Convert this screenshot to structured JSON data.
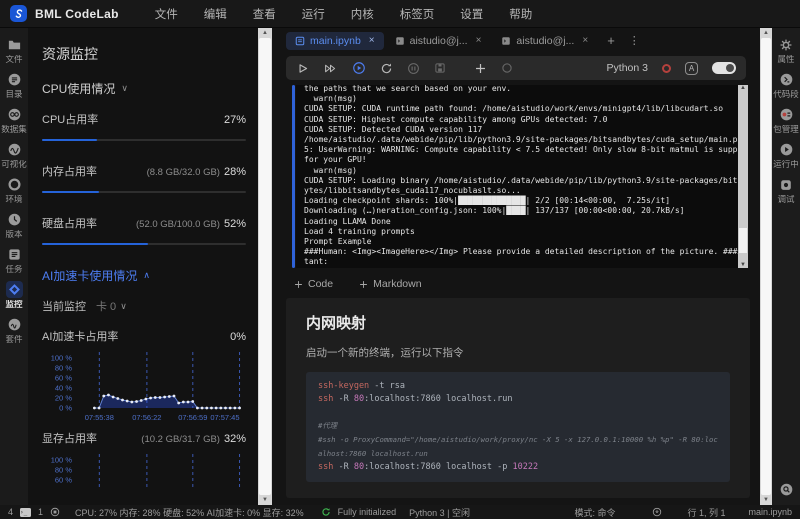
{
  "app": {
    "logo_text": "BML CodeLab",
    "menus": [
      "文件",
      "编辑",
      "查看",
      "运行",
      "内核",
      "标签页",
      "设置",
      "帮助"
    ]
  },
  "left_bar": {
    "items": [
      {
        "label": "文件"
      },
      {
        "label": "目录"
      },
      {
        "label": "数据集"
      },
      {
        "label": "可视化"
      },
      {
        "label": "环境"
      },
      {
        "label": "版本"
      },
      {
        "label": "任务"
      },
      {
        "label": "监控",
        "active": true
      },
      {
        "label": "套件"
      }
    ]
  },
  "panel": {
    "title": "资源监控",
    "cpu_section": "CPU使用情况",
    "ai_section": "AI加速卡使用情况",
    "monitor_label": "当前监控",
    "card_select": "卡 0",
    "metrics": [
      {
        "label": "CPU占用率",
        "detail": "",
        "value": "27%",
        "percent": 27
      },
      {
        "label": "内存占用率",
        "detail": "(8.8 GB/32.0 GB)",
        "value": "28%",
        "percent": 28
      },
      {
        "label": "硬盘占用率",
        "detail": "(52.0 GB/100.0 GB)",
        "value": "52%",
        "percent": 52
      }
    ]
  },
  "chart_data": [
    {
      "type": "area",
      "title": "AI加速卡占用率",
      "current_value": "0%",
      "ylabel": "",
      "xlabel": "",
      "ylim": [
        0,
        100
      ],
      "y_ticks": [
        100,
        80,
        60,
        40,
        20,
        0
      ],
      "y_tick_labels": [
        "100 %",
        "80 %",
        "60 %",
        "40 %",
        "20 %",
        "0 %"
      ],
      "x_ticks": [
        "07:55:38",
        "07:56:22",
        "07:56:59",
        "07:57:45"
      ],
      "grid": "vertical-dashed",
      "legend": "none",
      "line_color": "#6383d6",
      "fill_color": "rgba(47,84,235,0.35)",
      "values": [
        0,
        0,
        24,
        26,
        22,
        19,
        16,
        14,
        12,
        13,
        15,
        18,
        20,
        21,
        21,
        22,
        23,
        24,
        10,
        12,
        12,
        13,
        0,
        0,
        0,
        0,
        0,
        0,
        0,
        0,
        0,
        0
      ]
    },
    {
      "type": "area",
      "title": "显存占用率",
      "detail": "(10.2 GB/31.7 GB)",
      "current_value": "32%",
      "ylim": [
        0,
        100
      ],
      "y_ticks": [
        100,
        80,
        60
      ],
      "y_tick_labels": [
        "100 %",
        "80 %",
        "60 %"
      ],
      "x_ticks": [],
      "grid": "vertical-dashed",
      "values": [],
      "note": "chart clipped by viewport bottom"
    }
  ],
  "notebook": {
    "tabs": [
      {
        "label": "main.ipynb",
        "close": "×",
        "active": true
      },
      {
        "label": "aistudio@j...",
        "close": "×",
        "active": false
      },
      {
        "label": "aistudio@j...",
        "close": "×",
        "active": false
      }
    ],
    "toolbar": {
      "kernel_label": "Python 3"
    },
    "console_lines": [
      "the paths that we search based on your env.",
      "  warn(msg)",
      "CUDA SETUP: CUDA runtime path found: /home/aistudio/work/envs/minigpt4/lib/libcudart.so",
      "CUDA SETUP: Highest compute capability among GPUs detected: 7.0",
      "CUDA SETUP: Detected CUDA version 117",
      "/home/aistudio/.data/webide/pip/lib/python3.9/site-packages/bitsandbytes/cuda_setup/main.py:14",
      "5: UserWarning: WARNING: Compute capability < 7.5 detected! Only slow 8-bit matmul is supported",
      "for your GPU!",
      "  warn(msg)",
      "CUDA SETUP: Loading binary /home/aistudio/.data/webide/pip/lib/python3.9/site-packages/bitsandb",
      "ytes/libbitsandbytes_cuda117_nocublaslt.so...",
      "Loading checkpoint shards: 100%|██████████████| 2/2 [00:14<00:00,  7.25s/it]",
      "Downloading (…)neration_config.json: 100%|████| 137/137 [00:00<00:00, 20.7kB/s]",
      "Loading LLAMA Done",
      "Load 4 training prompts",
      "Prompt Example",
      "###Human: <Img><ImageHere></Img> Please provide a detailed description of the picture. ###Assis",
      "tant:"
    ],
    "add_code": "Code",
    "add_markdown": "Markdown",
    "markdown_cell": {
      "heading": "内网映射",
      "paragraph": "启动一个新的终端，运行以下指令",
      "code_lines": [
        [
          [
            "ssh-keygen",
            "kw"
          ],
          [
            " -t rsa",
            "plain"
          ]
        ],
        [
          [
            "ssh",
            "kw"
          ],
          [
            " -R ",
            "plain"
          ],
          [
            "80",
            "num"
          ],
          [
            ":localhost:7860 localhost.run",
            "plain"
          ]
        ],
        [],
        [
          [
            "#代理",
            "comment"
          ]
        ],
        [
          [
            "#ssh -o ProxyCommand=\"/home/aistudio/work/proxy/nc -X 5 -x 127.0.0.1:10000 %h %p\" -R 80:localhost:7860 localhost.run",
            "comment"
          ]
        ],
        [
          [
            "ssh",
            "kw"
          ],
          [
            " -R ",
            "plain"
          ],
          [
            "80",
            "num"
          ],
          [
            ":localhost:7860 localhost -p ",
            "plain"
          ],
          [
            "10222",
            "num"
          ]
        ]
      ]
    }
  },
  "right_bar": {
    "items": [
      {
        "label": "属性"
      },
      {
        "label": "代码段"
      },
      {
        "label": "包管理"
      },
      {
        "label": "运行中"
      },
      {
        "label": "调试"
      }
    ]
  },
  "status_bar": {
    "terminal_count": "4",
    "kernel_count": "1",
    "resources": "CPU: 27% 内存: 28% 硬盘: 52% AI加速卡: 0% 显存: 32%",
    "init_status": "Fully initialized",
    "kernel_status": "Python 3 | 空闲",
    "mode": "模式: 命令",
    "cursor": "行 1, 列 1",
    "filename": "main.ipynb"
  },
  "colors": {
    "accent_blue": "#2563d9",
    "active_tab_text": "#5b8def",
    "chart_line": "#6383d6",
    "kernel_busy_red": "#b5413d",
    "sync_green": "#3fb950"
  }
}
